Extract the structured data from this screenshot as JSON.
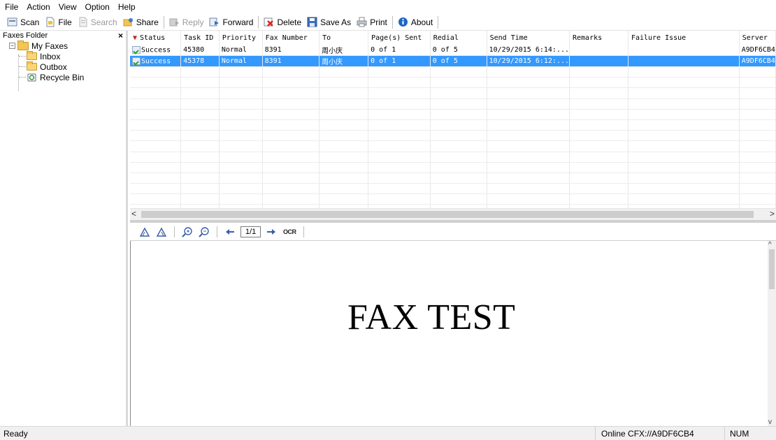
{
  "menu": [
    "File",
    "Action",
    "View",
    "Option",
    "Help"
  ],
  "toolbar": {
    "scan": "Scan",
    "file": "File",
    "search": "Search",
    "share": "Share",
    "reply": "Reply",
    "forward": "Forward",
    "delete": "Delete",
    "save_as": "Save As",
    "print": "Print",
    "about": "About"
  },
  "sidebar": {
    "title": "Faxes Folder",
    "close": "×",
    "root": "My Faxes",
    "expander": "−",
    "items": [
      "Inbox",
      "Outbox",
      "Recycle Bin"
    ]
  },
  "grid": {
    "columns": [
      "Status",
      "Task ID",
      "Priority",
      "Fax Number",
      "To",
      "Page(s) Sent",
      "Redial",
      "Send Time",
      "Remarks",
      "Failure Issue",
      "Server"
    ],
    "rows": [
      [
        "Success",
        "45380",
        "Normal",
        "8391",
        "周小庆",
        "0 of  1",
        "0 of 5",
        "10/29/2015 6:14:...",
        "",
        "",
        "A9DF6CB4"
      ],
      [
        "Success",
        "45378",
        "Normal",
        "8391",
        "周小庆",
        "0 of  1",
        "0 of 5",
        "10/29/2015 6:12:...",
        "",
        "",
        "A9DF6CB4"
      ]
    ],
    "selected_row": 1
  },
  "scroll": {
    "left": "<",
    "right": ">",
    "up": "^",
    "down": "v"
  },
  "viewer": {
    "page": "1/1",
    "ocr": "OCR",
    "content": "FAX TEST"
  },
  "status": {
    "ready": "Ready",
    "online": "Online CFX://A9DF6CB4",
    "num": "NUM"
  },
  "colors": {
    "selection": "#3399ff",
    "folder": "#f3c552",
    "toolbar_icon": "#3a5da8"
  }
}
